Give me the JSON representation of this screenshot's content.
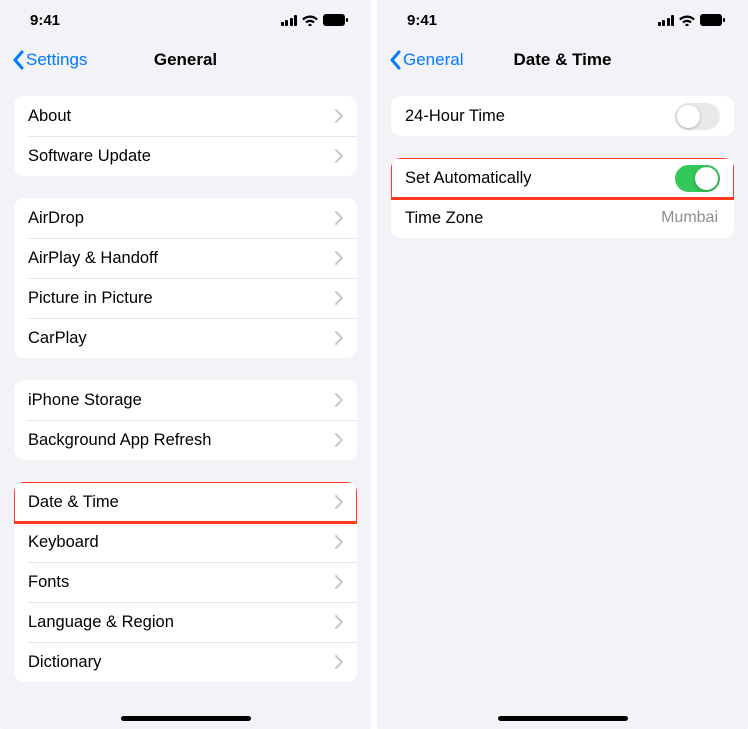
{
  "status": {
    "time": "9:41"
  },
  "left": {
    "back_label": "Settings",
    "title": "General",
    "group1": [
      {
        "label": "About"
      },
      {
        "label": "Software Update"
      }
    ],
    "group2": [
      {
        "label": "AirDrop"
      },
      {
        "label": "AirPlay & Handoff"
      },
      {
        "label": "Picture in Picture"
      },
      {
        "label": "CarPlay"
      }
    ],
    "group3": [
      {
        "label": "iPhone Storage"
      },
      {
        "label": "Background App Refresh"
      }
    ],
    "group4": [
      {
        "label": "Date & Time"
      },
      {
        "label": "Keyboard"
      },
      {
        "label": "Fonts"
      },
      {
        "label": "Language & Region"
      },
      {
        "label": "Dictionary"
      }
    ]
  },
  "right": {
    "back_label": "General",
    "title": "Date & Time",
    "row_24h": {
      "label": "24-Hour Time",
      "on": false
    },
    "row_auto": {
      "label": "Set Automatically",
      "on": true
    },
    "row_tz": {
      "label": "Time Zone",
      "value": "Mumbai"
    }
  }
}
